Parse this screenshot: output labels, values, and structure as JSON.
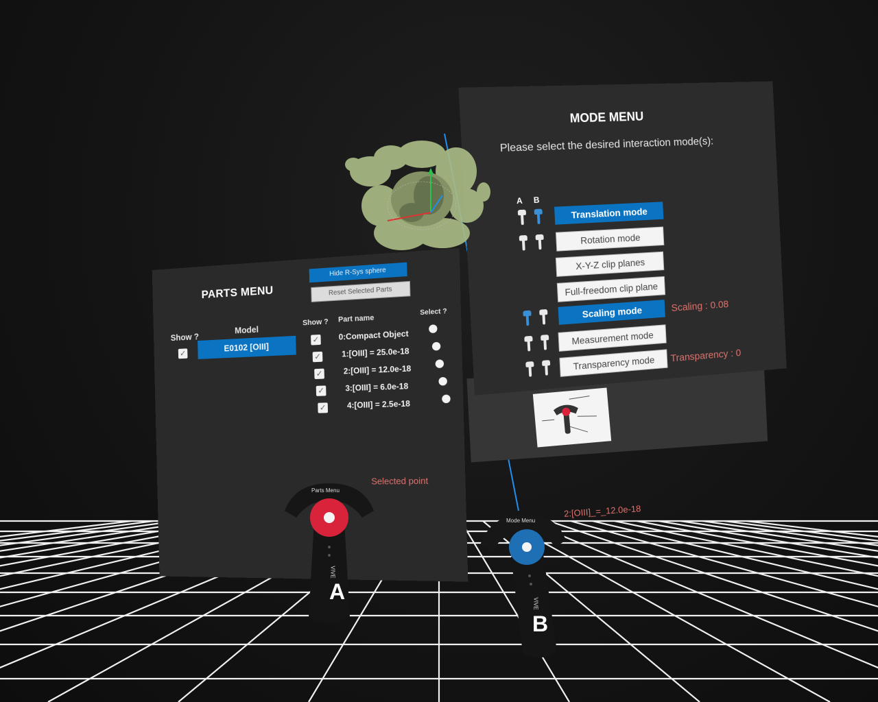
{
  "parts_menu": {
    "title": "PARTS MENU",
    "hide_button": "Hide R-Sys sphere",
    "reset_button": "Reset Selected Parts",
    "show_header": "Show ?",
    "model_header": "Model",
    "model_name": "E0102 [OIII]",
    "parts_show_header": "Show ?",
    "part_name_header": "Part name",
    "select_header": "Select ?",
    "parts": [
      {
        "name": "0:Compact Object"
      },
      {
        "name": "1:[OIII] = 25.0e-18"
      },
      {
        "name": "2:[OIII] = 12.0e-18"
      },
      {
        "name": "3:[OIII] = 6.0e-18"
      },
      {
        "name": "4:[OIII] = 2.5e-18"
      }
    ],
    "selected_point_label": "Selected point"
  },
  "mode_menu": {
    "title": "MODE MENU",
    "prompt": "Please select the desired interaction mode(s):",
    "col_a": "A",
    "col_b": "B",
    "modes": [
      {
        "label": "Translation mode",
        "active": true
      },
      {
        "label": "Rotation mode",
        "active": false
      },
      {
        "label": "X-Y-Z clip planes",
        "active": false
      },
      {
        "label": "Full-freedom clip plane",
        "active": false
      },
      {
        "label": "Scaling mode",
        "active": true
      },
      {
        "label": "Measurement mode",
        "active": false
      },
      {
        "label": "Transparency mode",
        "active": false
      }
    ],
    "scaling_info": "Scaling : 0.08",
    "transparency_info": "Transparency : 0"
  },
  "controllers": {
    "left": {
      "label": "A",
      "tag": "Parts Menu",
      "brand": "VIVE",
      "touchpad_color": "#d8233a"
    },
    "right": {
      "label": "B",
      "tag": "Mode Menu",
      "brand": "VIVE",
      "touchpad_color": "#1f6fb4"
    }
  },
  "selected_value": "2:[OIII]_=_12.0e-18",
  "colors": {
    "accent_blue": "#0a74c2",
    "info_red": "#e0726d",
    "nebula": "#a9ba85"
  }
}
